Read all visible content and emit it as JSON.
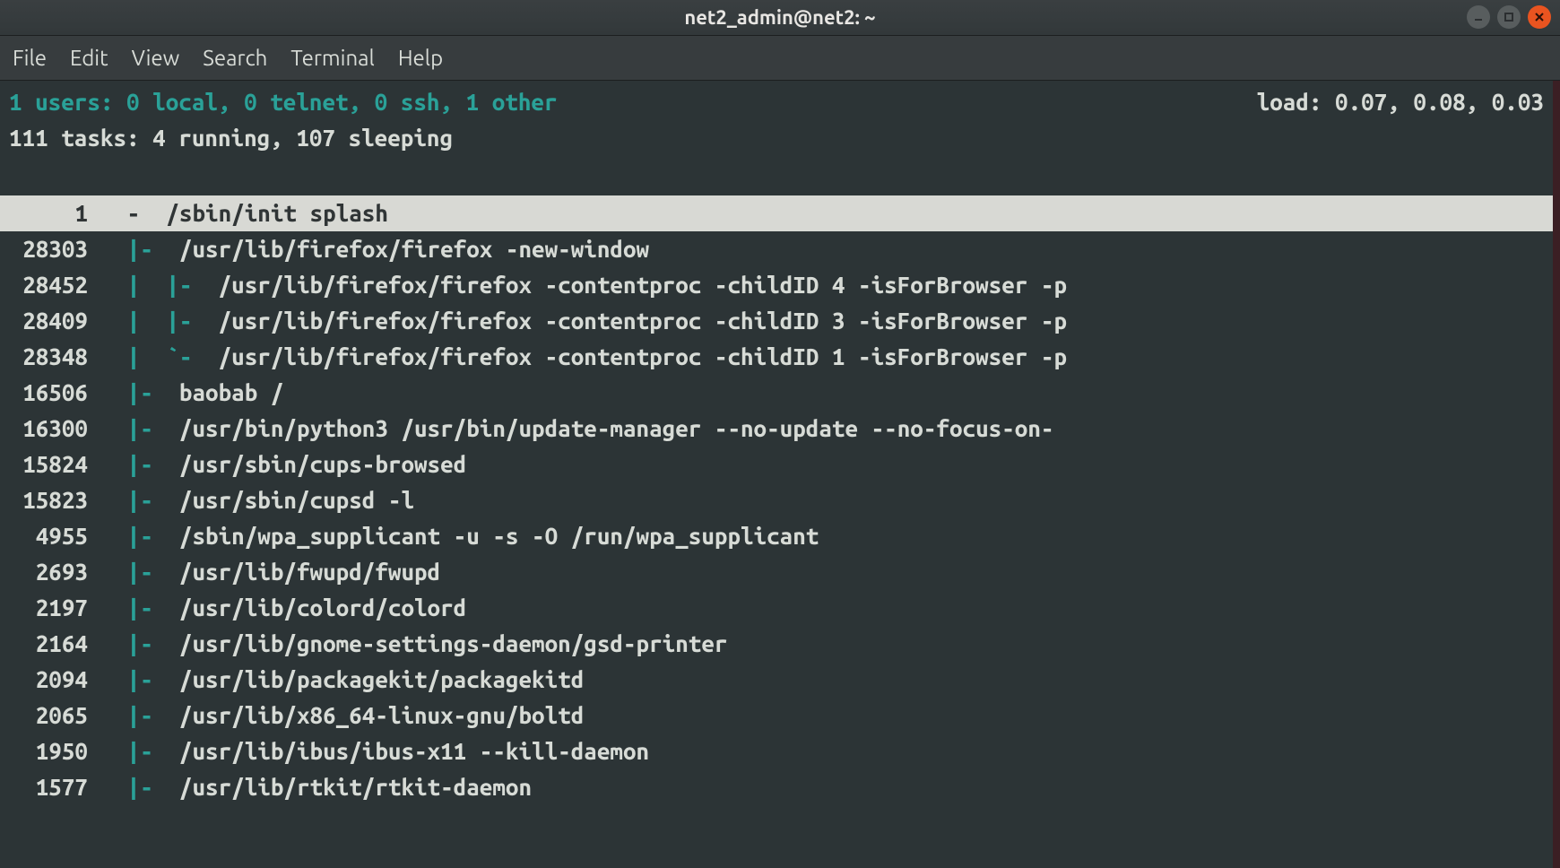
{
  "window": {
    "title": "net2_admin@net2: ~"
  },
  "menu": {
    "items": [
      "File",
      "Edit",
      "View",
      "Search",
      "Terminal",
      "Help"
    ]
  },
  "header": {
    "users_line": "1 users: 0 local, 0 telnet, 0 ssh, 1 other",
    "load_line": "load: 0.07, 0.08, 0.03",
    "tasks_line": "111 tasks: 4 running, 107 sleeping"
  },
  "processes": [
    {
      "pid": "1",
      "tree": "   -  ",
      "cmd": "/sbin/init splash",
      "selected": true
    },
    {
      "pid": "28303",
      "tree": "   |-  ",
      "cmd": "/usr/lib/firefox/firefox -new-window"
    },
    {
      "pid": "28452",
      "tree": "   |  |-  ",
      "cmd": "/usr/lib/firefox/firefox -contentproc -childID 4 -isForBrowser -p"
    },
    {
      "pid": "28409",
      "tree": "   |  |-  ",
      "cmd": "/usr/lib/firefox/firefox -contentproc -childID 3 -isForBrowser -p"
    },
    {
      "pid": "28348",
      "tree": "   |  `-  ",
      "cmd": "/usr/lib/firefox/firefox -contentproc -childID 1 -isForBrowser -p"
    },
    {
      "pid": "16506",
      "tree": "   |-  ",
      "cmd": "baobab /"
    },
    {
      "pid": "16300",
      "tree": "   |-  ",
      "cmd": "/usr/bin/python3 /usr/bin/update-manager --no-update --no-focus-on-"
    },
    {
      "pid": "15824",
      "tree": "   |-  ",
      "cmd": "/usr/sbin/cups-browsed"
    },
    {
      "pid": "15823",
      "tree": "   |-  ",
      "cmd": "/usr/sbin/cupsd -l"
    },
    {
      "pid": "4955",
      "tree": "   |-  ",
      "cmd": "/sbin/wpa_supplicant -u -s -O /run/wpa_supplicant"
    },
    {
      "pid": "2693",
      "tree": "   |-  ",
      "cmd": "/usr/lib/fwupd/fwupd"
    },
    {
      "pid": "2197",
      "tree": "   |-  ",
      "cmd": "/usr/lib/colord/colord"
    },
    {
      "pid": "2164",
      "tree": "   |-  ",
      "cmd": "/usr/lib/gnome-settings-daemon/gsd-printer"
    },
    {
      "pid": "2094",
      "tree": "   |-  ",
      "cmd": "/usr/lib/packagekit/packagekitd"
    },
    {
      "pid": "2065",
      "tree": "   |-  ",
      "cmd": "/usr/lib/x86_64-linux-gnu/boltd"
    },
    {
      "pid": "1950",
      "tree": "   |-  ",
      "cmd": "/usr/lib/ibus/ibus-x11 --kill-daemon"
    },
    {
      "pid": "1577",
      "tree": "   |-  ",
      "cmd": "/usr/lib/rtkit/rtkit-daemon"
    }
  ]
}
